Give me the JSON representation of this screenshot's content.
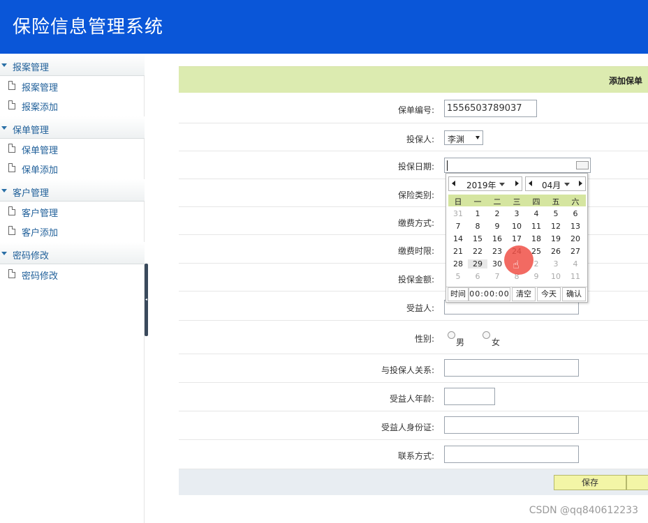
{
  "app": {
    "title": "保险信息管理系统"
  },
  "sidebar": {
    "groups": [
      {
        "label": "报案管理",
        "items": [
          "报案管理",
          "报案添加"
        ]
      },
      {
        "label": "保单管理",
        "items": [
          "保单管理",
          "保单添加"
        ]
      },
      {
        "label": "客户管理",
        "items": [
          "客户管理",
          "客户添加"
        ]
      },
      {
        "label": "密码修改",
        "items": [
          "密码修改"
        ]
      }
    ]
  },
  "form": {
    "header": "添加保单",
    "policy_no": {
      "label": "保单编号:",
      "value": "1556503789037"
    },
    "insured": {
      "label": "投保人:",
      "value": "李渊"
    },
    "date": {
      "label": "投保日期:",
      "value": ""
    },
    "category": {
      "label": "保险类别:"
    },
    "pay_method": {
      "label": "缴费方式:"
    },
    "pay_period": {
      "label": "缴费时限:"
    },
    "amount": {
      "label": "投保金额:"
    },
    "beneficiary": {
      "label": "受益人:"
    },
    "gender": {
      "label": "性别:",
      "male": "男",
      "female": "女"
    },
    "relation": {
      "label": "与投保人关系:"
    },
    "age": {
      "label": "受益人年龄:"
    },
    "id_card": {
      "label": "受益人身份证:"
    },
    "contact": {
      "label": "联系方式:"
    },
    "save": "保存"
  },
  "calendar": {
    "year": "2019年",
    "month": "04月",
    "weekdays": [
      "日",
      "一",
      "二",
      "三",
      "四",
      "五",
      "六"
    ],
    "weeks": [
      [
        "31",
        "1",
        "2",
        "3",
        "4",
        "5",
        "6"
      ],
      [
        "7",
        "8",
        "9",
        "10",
        "11",
        "12",
        "13"
      ],
      [
        "14",
        "15",
        "16",
        "17",
        "18",
        "19",
        "20"
      ],
      [
        "21",
        "22",
        "23",
        "24",
        "25",
        "26",
        "27"
      ],
      [
        "28",
        "29",
        "30",
        "1",
        "2",
        "3",
        "4"
      ],
      [
        "5",
        "6",
        "7",
        "8",
        "9",
        "10",
        "11"
      ]
    ],
    "time_label": "时间",
    "time_value": "00:00:00",
    "clear": "清空",
    "today": "今天",
    "confirm": "确认"
  },
  "colors": {
    "header": "#0a56d8",
    "accent": "#dcebb0",
    "highlight": "#f05046"
  },
  "watermark": "CSDN @qq840612233"
}
